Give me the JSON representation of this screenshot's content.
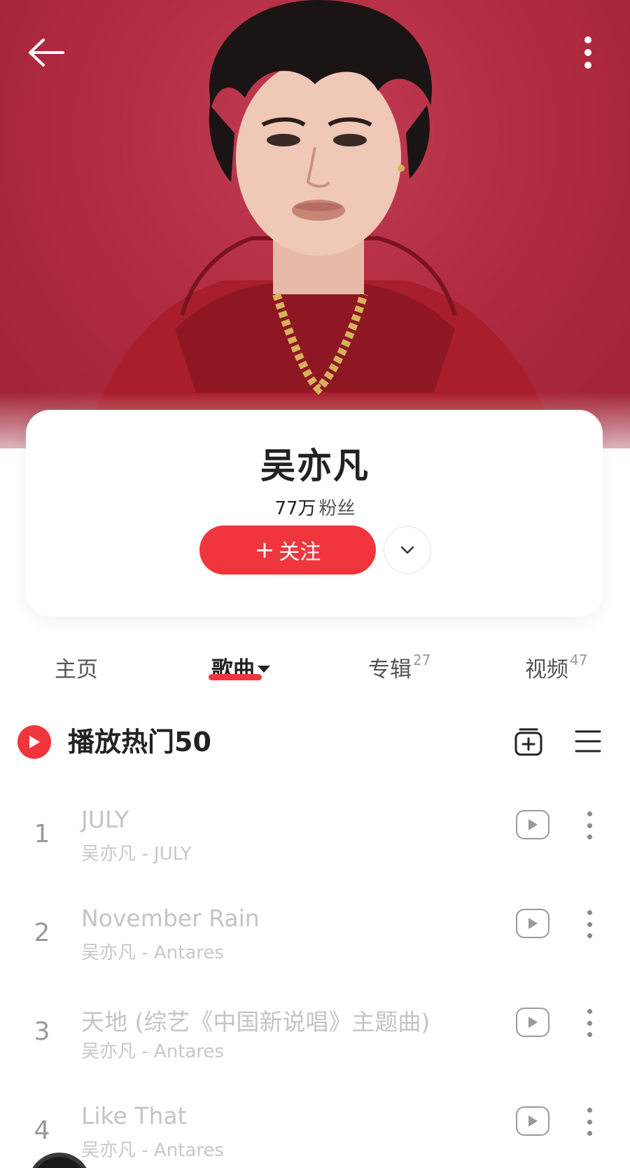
{
  "artist": {
    "name": "吴亦凡",
    "fans_count": "77万",
    "fans_label": "粉丝",
    "follow_label": "关注",
    "follow_plus": "+"
  },
  "tabs": [
    {
      "label": "主页",
      "badge": ""
    },
    {
      "label": "歌曲",
      "badge": ""
    },
    {
      "label": "专辑",
      "badge": "27"
    },
    {
      "label": "视频",
      "badge": "47"
    }
  ],
  "active_tab": "歌曲",
  "playlist": {
    "play_all_label": "播放热门50"
  },
  "songs": [
    {
      "index": "1",
      "title": "JULY",
      "subtitle": "吴亦凡 - JULY"
    },
    {
      "index": "2",
      "title": "November Rain",
      "subtitle": "吴亦凡 - Antares"
    },
    {
      "index": "3",
      "title": "天地 (综艺《中国新说唱》主题曲)",
      "subtitle": "吴亦凡 - Antares"
    },
    {
      "index": "4",
      "title": "Like That",
      "subtitle": "吴亦凡 - Antares"
    }
  ],
  "icons": {
    "back": "arrow-left-icon",
    "more": "more-vertical-icon",
    "dropdown": "chevron-down-icon",
    "play_all": "play-circle-icon",
    "add": "add-to-playlist-icon",
    "list": "menu-list-icon",
    "song_play": "play-box-icon",
    "song_more": "more-vertical-icon"
  },
  "colors": {
    "accent": "#f0353d",
    "hero_bg": "#b32c42"
  }
}
